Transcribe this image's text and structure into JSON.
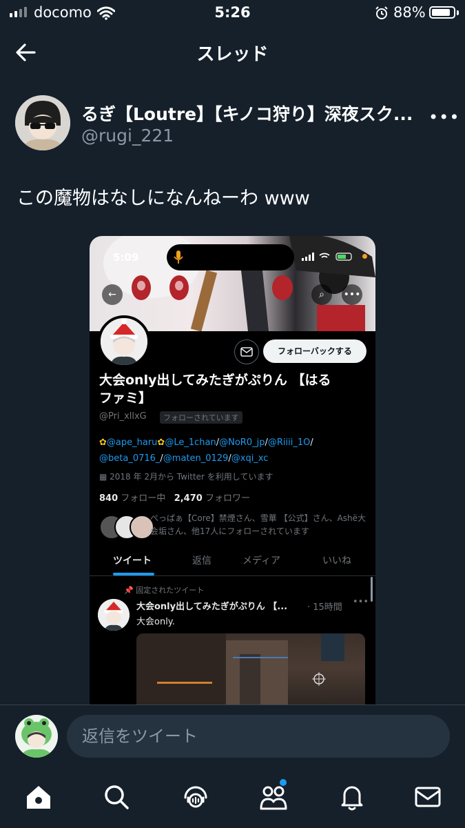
{
  "status_bar": {
    "carrier": "docomo",
    "time": "5:26",
    "battery_percent": "88%",
    "battery_level": 0.88
  },
  "header": {
    "title": "スレッド"
  },
  "tweet": {
    "author_name": "るぎ【Loutre】【キノコ狩り】深夜スク...",
    "author_handle": "@rugi_221",
    "text": "この魔物はなしになんねーわ www",
    "more_glyph": "•••"
  },
  "embedded_screenshot": {
    "time": "5:09",
    "profile": {
      "name_line1": "大会only出してみたぎがぷりん 【はる",
      "name_line2": "ファミ】",
      "handle": "@Pri_xllxG",
      "followed_badge": "フォローされています",
      "follow_back_label": "フォローバックする",
      "bio": [
        {
          "text": "@ape_haru",
          "link": true
        },
        {
          "text": "@Le_1chan",
          "link": true
        },
        {
          "text": "/",
          "link": false
        },
        {
          "text": "@NoR0_jp",
          "link": true
        },
        {
          "text": "/",
          "link": false
        },
        {
          "text": "@Riiii_1O",
          "link": true
        },
        {
          "text": "/",
          "link": false
        },
        {
          "text": "@beta_0716_",
          "link": true
        },
        {
          "text": "/",
          "link": false
        },
        {
          "text": "@maten_0129",
          "link": true
        },
        {
          "text": "/",
          "link": false
        },
        {
          "text": "@xqi_xc",
          "link": true
        }
      ],
      "joined": "2018 年 2月から Twitter を利用しています",
      "following_count": "840",
      "following_label": "フォロー中",
      "followers_count": "2,470",
      "followers_label": "フォロワー",
      "mutuals_text": "ぺっぱぁ【Core】禁煙さん、雪華 【公式】さん、Ashë大会垢さん、他17人にフォローされています"
    },
    "tabs": [
      "ツイート",
      "返信",
      "メディア",
      "いいね"
    ],
    "pinned_label": "固定されたツイート",
    "pinned_tweet": {
      "name": "大会only出してみたぎがぷりん 【...",
      "time": "· 15時間",
      "text": "大会only."
    }
  },
  "reply": {
    "placeholder": "返信をツイート"
  },
  "tabbar": {
    "items": [
      "home-icon",
      "search-icon",
      "spaces-icon",
      "communities-icon",
      "notifications-icon",
      "messages-icon"
    ]
  }
}
